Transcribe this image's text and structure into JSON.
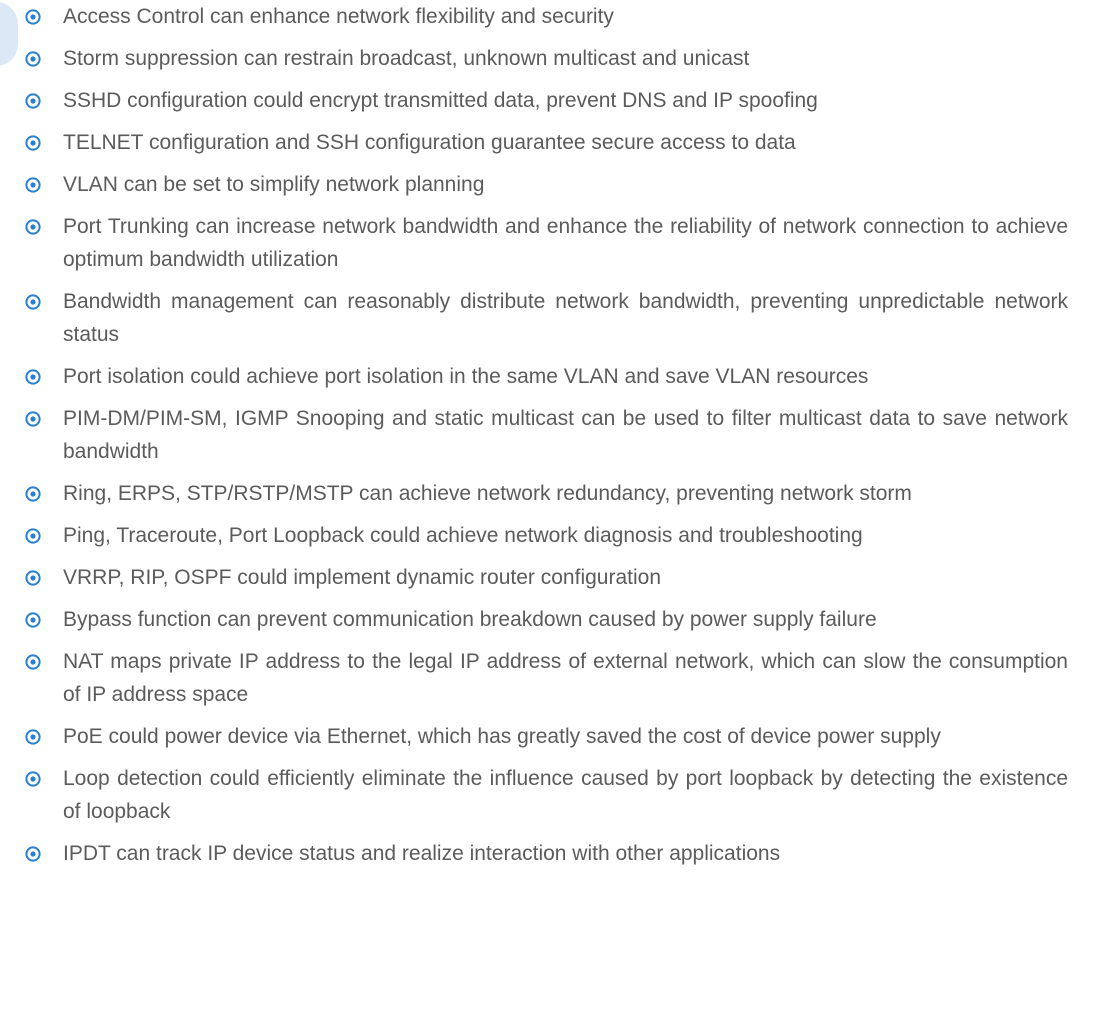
{
  "colors": {
    "bullet": "#2a7fd0",
    "text": "#5b5b5b",
    "edge_shape": "#dbe9f6"
  },
  "bullet_icon": "circled-dot-icon",
  "features": [
    "Access Control can enhance network flexibility and security",
    "Storm suppression can restrain broadcast, unknown multicast and unicast",
    "SSHD configuration could encrypt transmitted data, prevent DNS and IP spoofing",
    "TELNET configuration and SSH configuration guarantee secure access to data",
    "VLAN can be set to simplify network planning",
    "Port Trunking can increase network bandwidth and enhance the reliability of network connection to achieve optimum bandwidth utilization",
    "Bandwidth management can reasonably distribute network bandwidth, preventing unpredictable network status",
    "Port isolation could achieve port isolation in the same VLAN and save VLAN resources",
    "PIM-DM/PIM-SM, IGMP Snooping and static multicast can be used to filter multicast data to save network bandwidth",
    "Ring, ERPS, STP/RSTP/MSTP can achieve network redundancy, preventing network storm",
    "Ping, Traceroute, Port Loopback could achieve network diagnosis and troubleshooting",
    "VRRP, RIP, OSPF could implement dynamic router configuration",
    "Bypass function can prevent communication breakdown caused by power supply failure",
    "NAT maps private IP address to the legal IP address of external network, which can slow the consumption of IP address space",
    "PoE could power device via Ethernet, which has greatly saved the cost of device power supply",
    "Loop detection could efficiently eliminate the influence caused by port loopback by detecting the existence of loopback",
    "IPDT can track IP device status and realize interaction with other applications"
  ]
}
